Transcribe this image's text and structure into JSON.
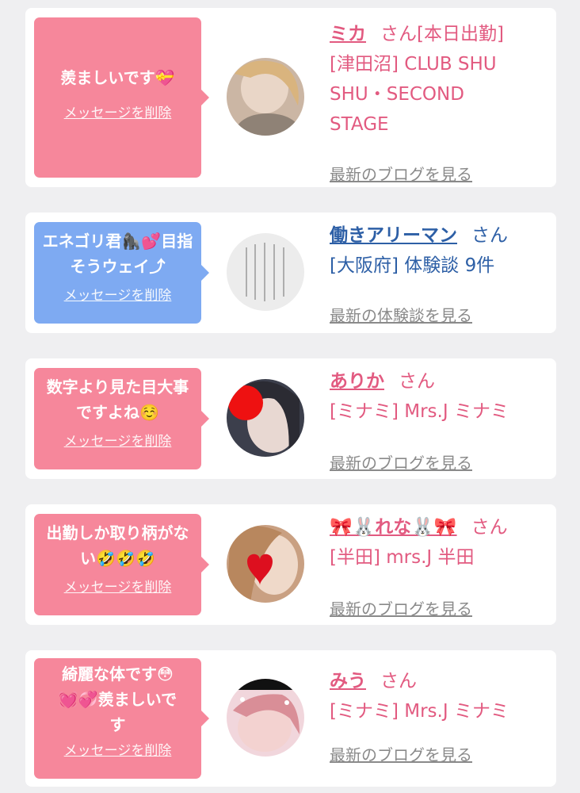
{
  "delete_label": "メッセージを削除",
  "cards": [
    {
      "message": "羨ましいです💝",
      "name": "ミカ",
      "honorific": "さん",
      "status": "[本日出勤]",
      "location_lines": [
        "[津田沼] CLUB SHU",
        "SHU・SECOND",
        "STAGE"
      ],
      "link": "最新のブログを見る"
    },
    {
      "message": "エネゴリ君🦍💕目指そうウェイ⤴",
      "name": "働きアリーマン",
      "honorific": "さん",
      "status": "",
      "location_lines": [
        "[大阪府] 体験談 9件"
      ],
      "link": "最新の体験談を見る"
    },
    {
      "message": "数字より見た目大事ですよね☺️",
      "name": "ありか",
      "honorific": "さん",
      "status": "",
      "location_lines": [
        "[ミナミ] Mrs.J ミナミ"
      ],
      "link": "最新のブログを見る"
    },
    {
      "message": "出勤しか取り柄がない🤣🤣🤣",
      "name": "🎀🐰れな🐰🎀",
      "honorific": "さん",
      "status": "",
      "location_lines": [
        "[半田] mrs.J 半田"
      ],
      "link": "最新のブログを見る"
    },
    {
      "message": "綺麗な体です😳💓💞羨ましいです",
      "name": "みう",
      "honorific": "さん",
      "status": "",
      "location_lines": [
        "[ミナミ] Mrs.J ミナミ"
      ],
      "link": "最新のブログを見る"
    }
  ],
  "colors": {
    "pink_bubble": "#f6879b",
    "blue_bubble": "#7eaaf2",
    "pink_text": "#e25a80",
    "blue_text": "#2d5fa6"
  }
}
